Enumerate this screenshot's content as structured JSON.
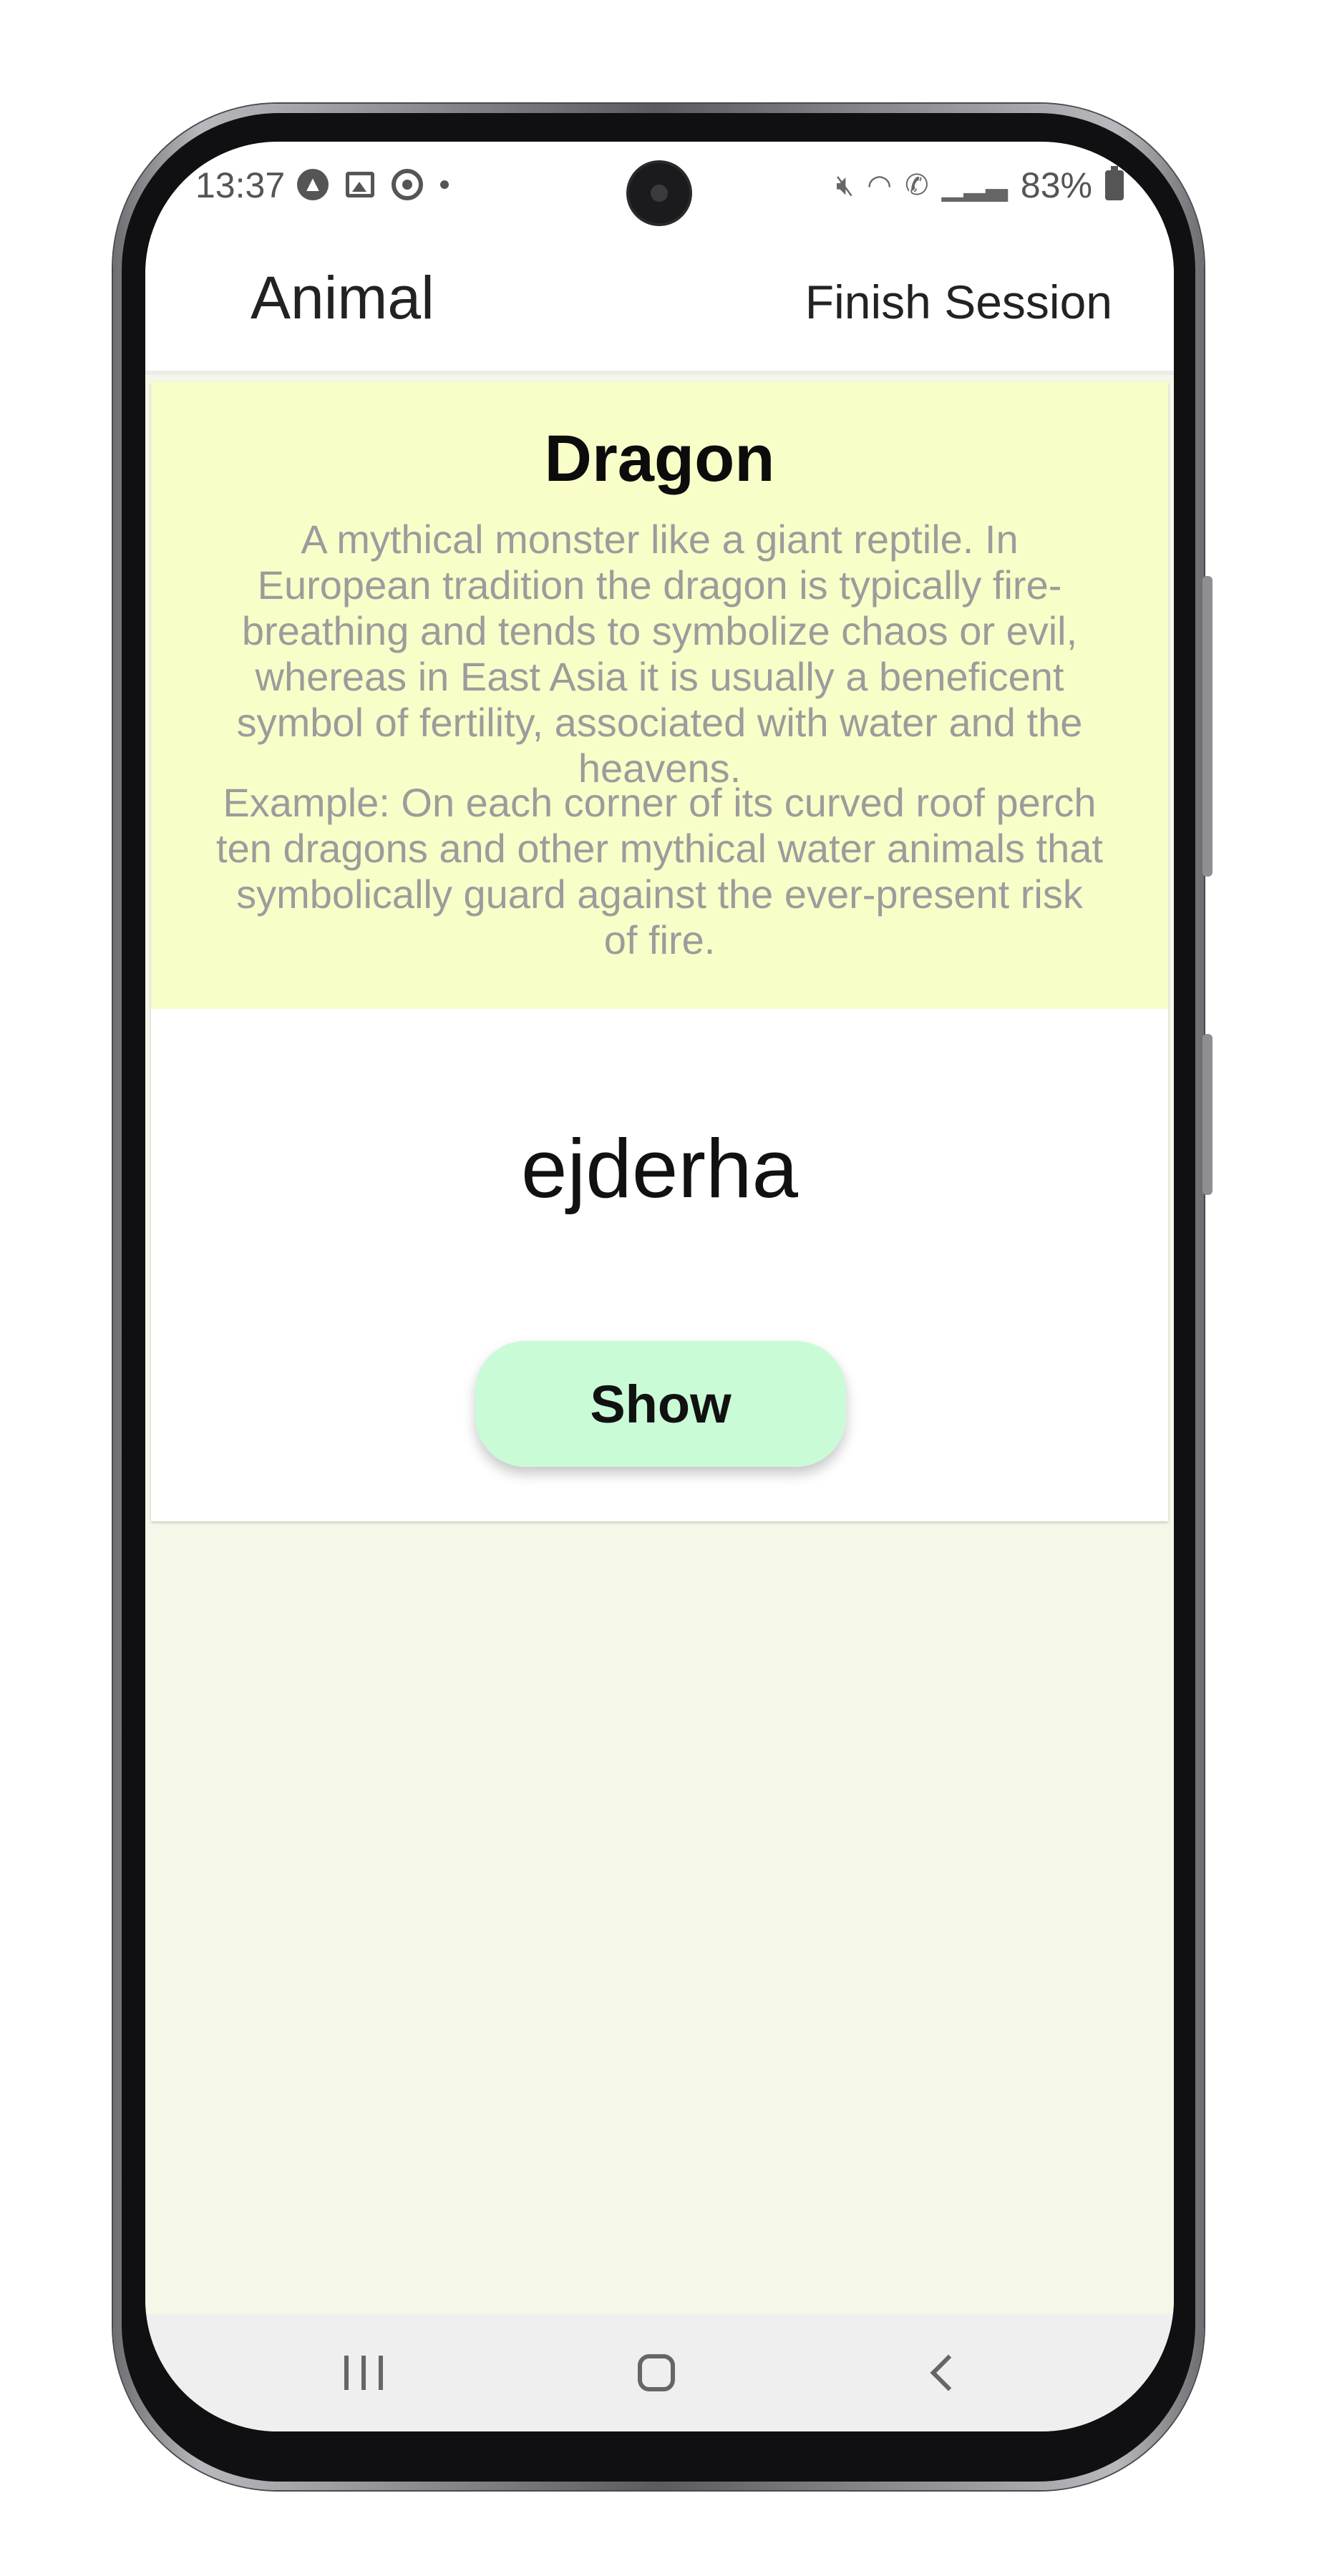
{
  "status_bar": {
    "time": "13:37",
    "left_icons": [
      "app-a-icon",
      "gallery-icon",
      "chrome-icon",
      "notification-dot-icon"
    ],
    "right_icons": [
      "mute-icon",
      "wifi-icon",
      "volte-call-icon",
      "signal-icon"
    ],
    "battery": "83%"
  },
  "header": {
    "category": "Animal",
    "finish_label": "Finish Session"
  },
  "card": {
    "word": "Dragon",
    "definition": "A mythical monster like a giant reptile. In European tradition the dragon is typically fire-breathing and tends to symbolize chaos or evil, whereas in East Asia it is usually a beneficent symbol of fertility, associated with water and the heavens.",
    "example": "Example: On each corner of its curved roof perch ten dragons and other mythical water animals that symbolically guard against the ever-present risk of fire.",
    "translation": "ejderha",
    "show_label": "Show"
  },
  "nav": {
    "recents_icon": "recents-icon",
    "home_icon": "home-icon",
    "back_icon": "back-icon"
  },
  "colors": {
    "card_top": "#f9fdc8",
    "show_button": "#c9fbd7",
    "page_background": "#f5f7e9"
  }
}
